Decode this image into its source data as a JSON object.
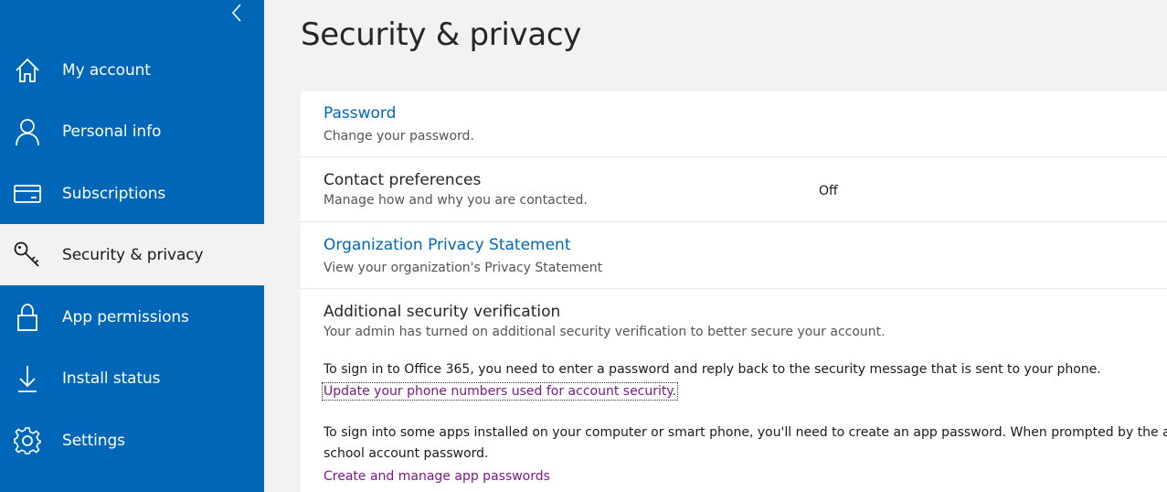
{
  "sidebar": {
    "collapse_icon": "chevron-left-icon",
    "items": [
      {
        "label": "My account",
        "icon": "home-icon"
      },
      {
        "label": "Personal info",
        "icon": "person-icon"
      },
      {
        "label": "Subscriptions",
        "icon": "credit-card-icon"
      },
      {
        "label": "Security & privacy",
        "icon": "key-icon",
        "selected": true
      },
      {
        "label": "App permissions",
        "icon": "lock-icon"
      },
      {
        "label": "Install status",
        "icon": "download-icon"
      },
      {
        "label": "Settings",
        "icon": "gear-icon"
      }
    ]
  },
  "main": {
    "title": "Security & privacy",
    "sections": {
      "password": {
        "title": "Password",
        "desc": "Change your password."
      },
      "contact": {
        "title": "Contact preferences",
        "desc": "Manage how and why you are contacted.",
        "value": "Off"
      },
      "privacy": {
        "title": "Organization Privacy Statement",
        "desc": "View your organization's Privacy Statement"
      },
      "verification": {
        "title": "Additional security verification",
        "desc": "Your admin has turned on additional security verification to better secure your account.",
        "para1": "To sign in to Office 365, you need to enter a password and reply back to the security message that is sent to your phone.",
        "link1": "Update your phone numbers used for account security.",
        "para2_line1": "To sign into some apps installed on your computer or smart phone, you'll need to create an app password. When prompted by the app, enter this password instead of your work or",
        "para2_line2": "school account password.",
        "link2": "Create and manage app passwords"
      }
    }
  },
  "colors": {
    "sidebar_bg": "#0067b8",
    "link_blue": "#0067b8",
    "link_purple": "#7a1a88",
    "page_bg": "#f2f2f2"
  }
}
